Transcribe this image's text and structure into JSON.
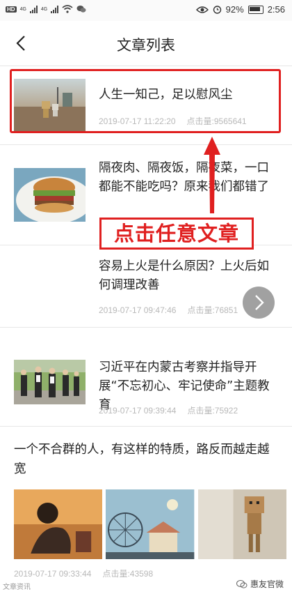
{
  "status_bar": {
    "hd": "HD",
    "net1": "4G",
    "net2": "4G",
    "battery": "92%",
    "time": "2:56"
  },
  "header": {
    "title": "文章列表"
  },
  "articles": [
    {
      "title": "人生一知己，足以慰风尘",
      "date": "2019-07-17 11:22:20",
      "views": "点击量:9565641"
    },
    {
      "title": "隔夜肉、隔夜饭，隔夜菜，一口都能不能吃吗？原来我们都错了"
    },
    {
      "title": "容易上火是什么原因？上火后如何调理改善",
      "date": "2019-07-17 09:47:46",
      "views": "点击量:76851"
    },
    {
      "title": "习近平在内蒙古考察并指导开展“不忘初心、牢记使命”主题教育",
      "date": "2019-07-17 09:39:44",
      "views": "点击量:75922"
    },
    {
      "title": "一个不合群的人，有这样的特质，路反而越走越宽",
      "date": "2019-07-17 09:33:44",
      "views": "点击量:43598"
    }
  ],
  "annotation": {
    "callout": "点击任意文章",
    "color": "#e02020"
  },
  "watermark": {
    "left": "文章资讯",
    "right": "惠友官微"
  }
}
